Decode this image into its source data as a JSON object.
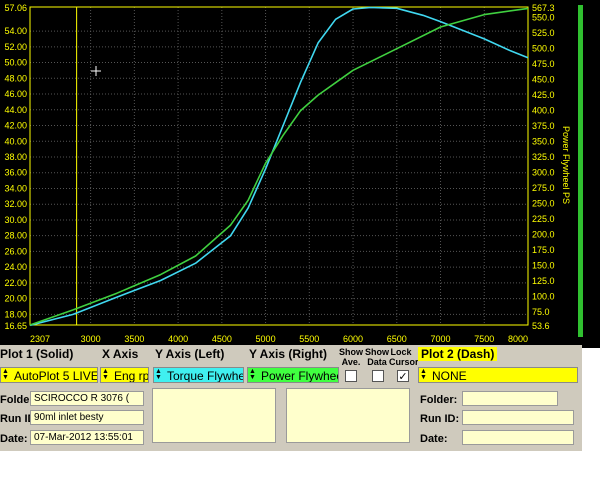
{
  "chart_data": {
    "type": "line",
    "xlabel": "",
    "ylabel": "",
    "y2label": "Power Flywheel PS",
    "xlim": [
      2307,
      8000
    ],
    "ylim": [
      16.65,
      57.06
    ],
    "y2lim": [
      53.6,
      567.3
    ],
    "x_ticks": [
      2307,
      3000,
      3500,
      4000,
      4500,
      5000,
      5500,
      6000,
      6500,
      7000,
      7500,
      8000
    ],
    "y_ticks": [
      "57.06",
      "54.00",
      "52.00",
      "50.00",
      "48.00",
      "46.00",
      "44.00",
      "42.00",
      "40.00",
      "38.00",
      "36.00",
      "34.00",
      "32.00",
      "30.00",
      "28.00",
      "26.00",
      "24.00",
      "22.00",
      "20.00",
      "18.00",
      "16.65"
    ],
    "y2_ticks": [
      "567.3",
      "550.0",
      "525.0",
      "500.0",
      "475.0",
      "450.0",
      "425.0",
      "400.0",
      "375.0",
      "350.0",
      "325.0",
      "300.0",
      "275.0",
      "250.0",
      "225.0",
      "200.0",
      "175.0",
      "150.0",
      "125.0",
      "100.0",
      "75.0",
      "53.6"
    ],
    "cursor_x": 2840,
    "series": [
      {
        "name": "Torque Flywheel",
        "axis": "left",
        "color": "#40d8f0",
        "x": [
          2307,
          2800,
          3300,
          3800,
          4200,
          4600,
          4800,
          5000,
          5200,
          5400,
          5600,
          5800,
          6000,
          6200,
          6500,
          6800,
          7000,
          7500,
          7800,
          8000
        ],
        "y": [
          16.6,
          18.0,
          20.2,
          22.3,
          24.5,
          28.0,
          31.5,
          36.5,
          42.0,
          47.5,
          52.5,
          55.5,
          56.8,
          57.0,
          56.9,
          56.0,
          55.2,
          53.0,
          51.5,
          50.6
        ]
      },
      {
        "name": "Power Flywheel",
        "axis": "right",
        "color": "#40d040",
        "x": [
          2307,
          2800,
          3300,
          3800,
          4200,
          4600,
          4800,
          5000,
          5200,
          5400,
          5600,
          5800,
          6000,
          6500,
          7000,
          7500,
          8000
        ],
        "y": [
          53.6,
          78,
          105,
          135,
          165,
          215,
          255,
          315,
          360,
          400,
          425,
          445,
          465,
          500,
          535,
          555,
          565
        ]
      }
    ]
  },
  "panel": {
    "plot1_title": "Plot 1 (Solid)",
    "xaxis_title": "X Axis",
    "yleft_title": "Y Axis (Left)",
    "yright_title": "Y Axis (Right)",
    "show_ave": "Show Ave.",
    "show_data": "Show Data",
    "lock_cursor": "Lock Cursor",
    "plot2_title": "Plot 2 (Dash)",
    "plot1_value": "AutoPlot 5 LIVE",
    "xaxis_value": "Eng rpm",
    "yleft_value": "Torque Flywheel",
    "yright_value": "Power Flywheel",
    "plot2_value": "NONE",
    "lock_mark": "✓",
    "folder_label": "Folder:",
    "runid_label": "Run ID:",
    "date_label": "Date:",
    "folder1": "SCIROCCO R 3076 (",
    "runid1": "90ml inlet besty",
    "date1": "07-Mar-2012  13:55:01",
    "folder2": "",
    "runid2": "",
    "date2": ""
  },
  "colors": {
    "yellow": "#ffff00",
    "cyan": "#40f0f0",
    "green": "#40ff40",
    "field": "#ffffcc",
    "panel": "#cfcabd"
  }
}
